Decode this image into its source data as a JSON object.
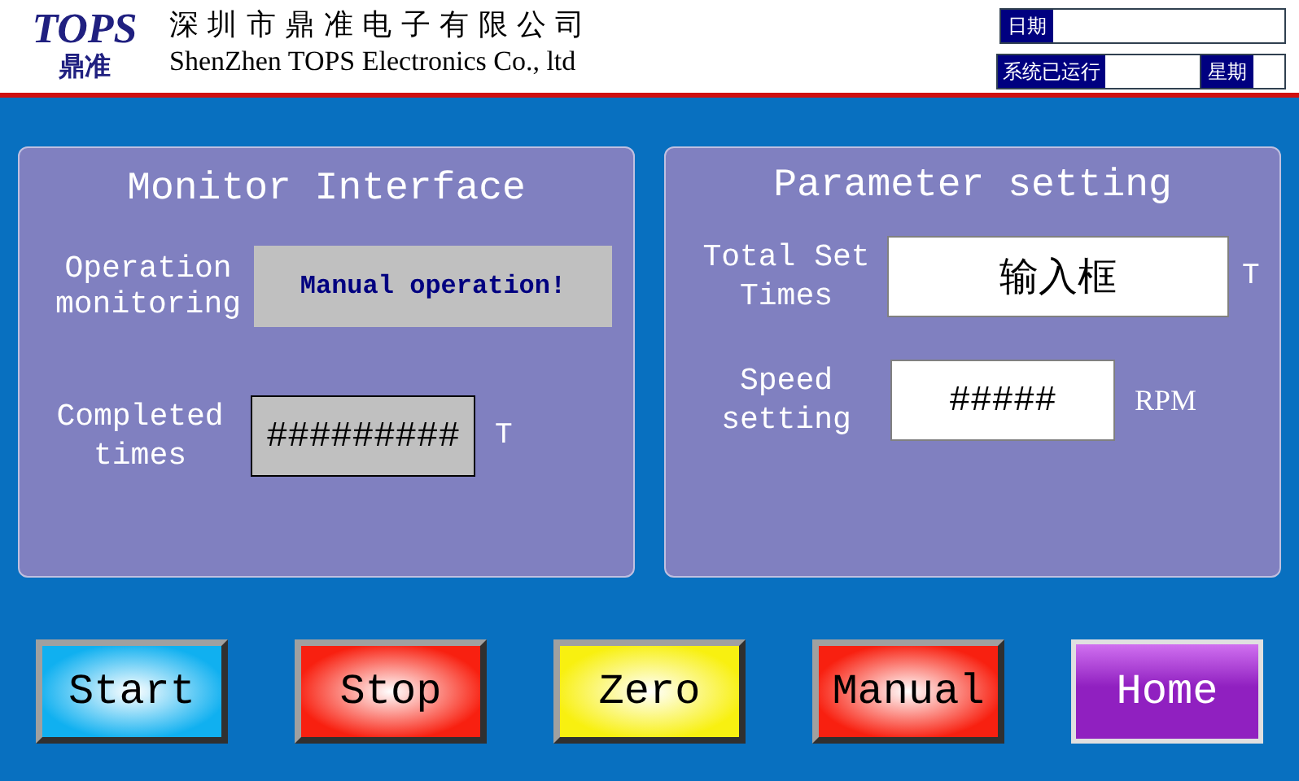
{
  "header": {
    "logo_latin": "TOPS",
    "logo_chinese": "鼎准",
    "company_cn": "深 圳 市 鼎 准 电 子 有 限 公 司",
    "company_en": "ShenZhen TOPS Electronics Co., ltd",
    "date_label": "日期",
    "runtime_label": "系统已运行",
    "weekday_label": "星期"
  },
  "monitor": {
    "title": "Monitor Interface",
    "operation_label": "Operation monitoring",
    "operation_value": "Manual operation!",
    "completed_label": "Completed times",
    "completed_value": "#########",
    "completed_unit": "T"
  },
  "parameters": {
    "title": "Parameter setting",
    "total_label": "Total Set Times",
    "total_value": "输入框",
    "total_unit": "T",
    "speed_label": "Speed setting",
    "speed_value": "#####",
    "speed_unit": "RPM"
  },
  "buttons": [
    {
      "label": "Start",
      "kind": "radial",
      "color": "#10b0f0"
    },
    {
      "label": "Stop",
      "kind": "radial",
      "color": "#f82010"
    },
    {
      "label": "Zero",
      "kind": "radial",
      "color": "#f8f010"
    },
    {
      "label": "Manual",
      "kind": "radial",
      "color": "#f82010"
    },
    {
      "label": "Home",
      "kind": "glossy",
      "color": "#9020c0"
    }
  ]
}
